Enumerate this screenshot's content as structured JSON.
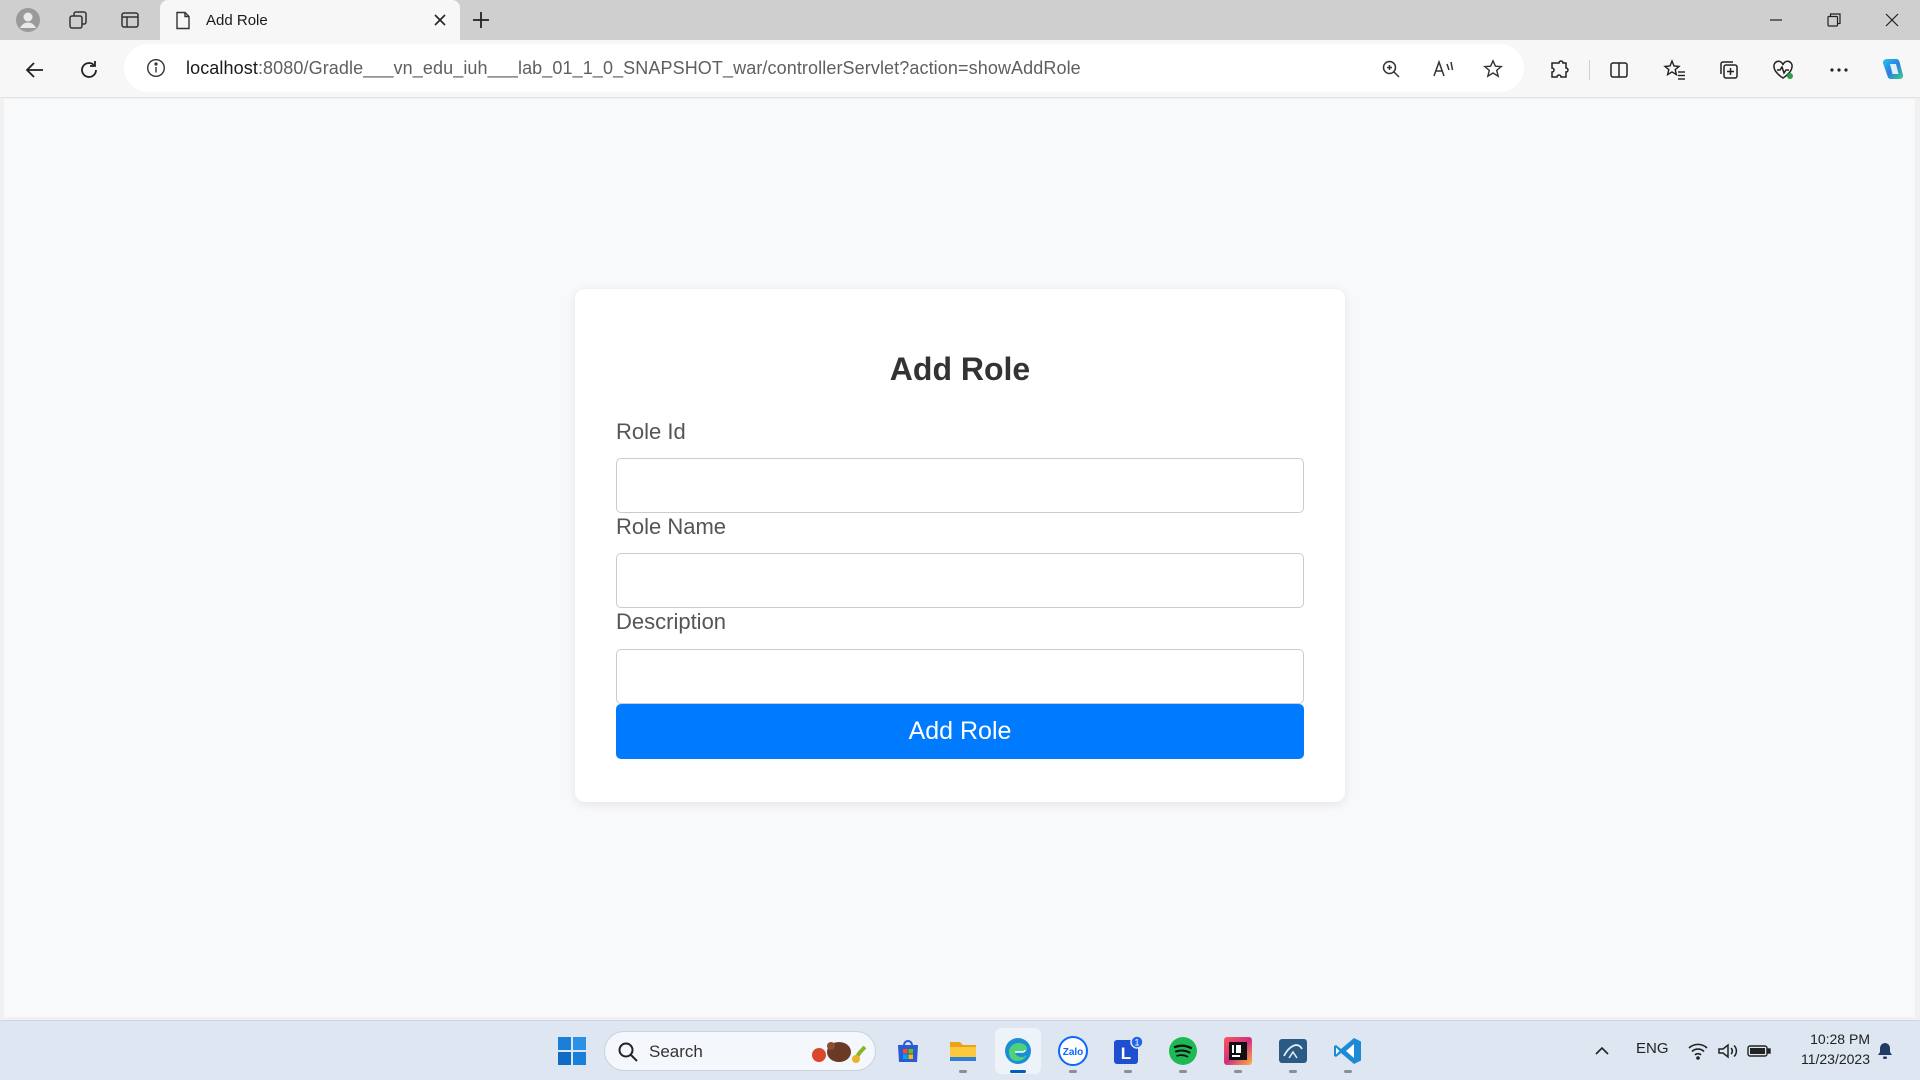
{
  "browser": {
    "tab": {
      "title": "Add Role"
    },
    "url": {
      "host": "localhost",
      "rest": ":8080/Gradle___vn_edu_iuh___lab_01_1_0_SNAPSHOT_war/controllerServlet?action=showAddRole"
    }
  },
  "form": {
    "title": "Add Role",
    "fields": [
      {
        "label": "Role Id",
        "value": ""
      },
      {
        "label": "Role Name",
        "value": ""
      },
      {
        "label": "Description",
        "value": ""
      }
    ],
    "submit_label": "Add Role",
    "submit_color": "#007bff"
  },
  "taskbar": {
    "search_label": "Search",
    "apps": [
      "start-icon",
      "store-icon",
      "file-explorer-icon",
      "edge-icon",
      "zalo-icon",
      "lark-icon",
      "spotify-icon",
      "intellij-icon",
      "mysql-workbench-icon",
      "vscode-icon"
    ],
    "zalo_text": "Zalo",
    "lark_letter": "L",
    "lark_badge": "1",
    "tray": {
      "language": "ENG",
      "time": "10:28 PM",
      "date": "11/23/2023"
    }
  }
}
